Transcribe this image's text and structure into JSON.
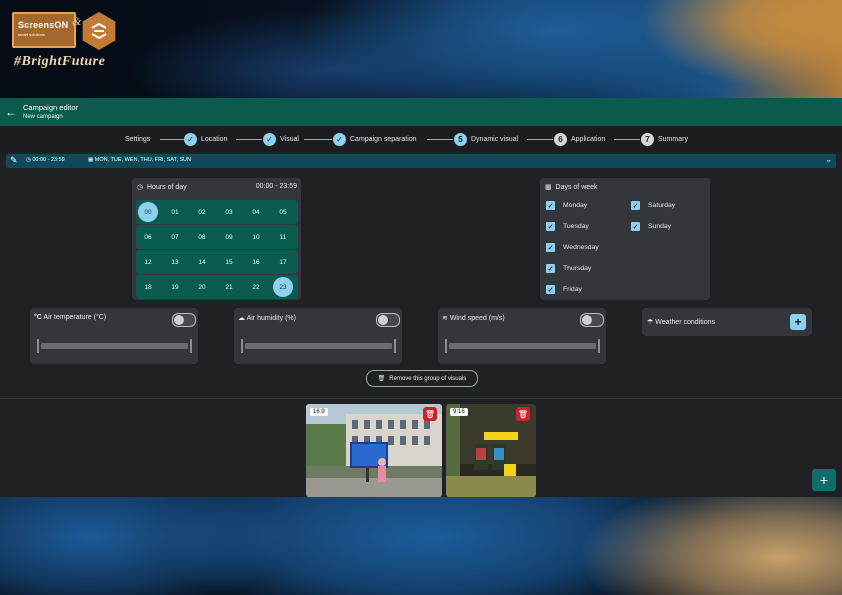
{
  "brand": {
    "logo_name": "ScreensON",
    "logo_sub": "smart solutions",
    "amp": "&",
    "tagline": "#BrightFuture"
  },
  "appbar": {
    "title": "Campaign editor",
    "subtitle": "New campaign"
  },
  "stepper": {
    "steps": [
      {
        "label": "Settings",
        "state": "label-only"
      },
      {
        "label": "Location",
        "state": "done"
      },
      {
        "label": "Visual",
        "state": "done"
      },
      {
        "label": "Campaign separation",
        "state": "done"
      },
      {
        "label": "Dynamic visual",
        "state": "active",
        "number": "5"
      },
      {
        "label": "Application",
        "state": "pending",
        "number": "6"
      },
      {
        "label": "Summary",
        "state": "pending",
        "number": "7"
      }
    ]
  },
  "group": {
    "time_range": "00:00 - 23:59",
    "days": "MON, TUE, WEN, THU, FRI, SAT, SUN"
  },
  "hours": {
    "title": "Hours of day",
    "range": "00:00 - 23:59",
    "rows": [
      [
        "00",
        "01",
        "02",
        "03",
        "04",
        "05"
      ],
      [
        "06",
        "07",
        "08",
        "09",
        "10",
        "11"
      ],
      [
        "12",
        "13",
        "14",
        "15",
        "16",
        "17"
      ],
      [
        "18",
        "19",
        "20",
        "21",
        "22",
        "23"
      ]
    ],
    "selected": [
      "00",
      "23"
    ]
  },
  "days_of_week": {
    "title": "Days of week",
    "col1": [
      "Monday",
      "Tuesday",
      "Wednesday",
      "Thursday",
      "Friday"
    ],
    "col2": [
      "Saturday",
      "Sunday"
    ]
  },
  "conditions": {
    "air_temp": {
      "label": "Air temperature (°C)",
      "icon_text": "°C",
      "enabled": false
    },
    "air_humidity": {
      "label": "Air humidity (%)",
      "enabled": false
    },
    "wind_speed": {
      "label": "Wind speed (m/s)",
      "enabled": false
    },
    "weather": {
      "label": "Weather conditions"
    }
  },
  "remove_group_label": "Remove this group of visuals",
  "visuals": [
    {
      "ratio": "16:9"
    },
    {
      "ratio": "9:16"
    }
  ],
  "colors": {
    "accent": "#8fd0f0",
    "appbar": "#0a5a4e",
    "hour_row": "#0b5c50",
    "delete": "#c6252b"
  }
}
